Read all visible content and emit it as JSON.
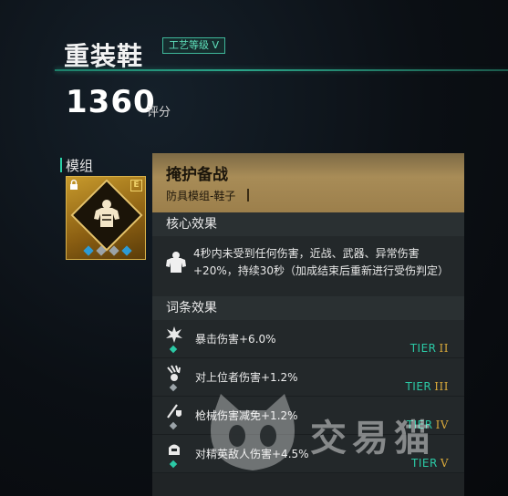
{
  "item": {
    "name": "重装鞋",
    "craft_badge": "工艺等级 V",
    "score": "1360",
    "score_unit": "评分"
  },
  "module_section": {
    "label": "模组",
    "grade_letter": "E",
    "icons": {
      "lock": "lock-icon",
      "figure": "armored-torso-icon"
    },
    "dots": [
      "#2d9bd6",
      "#9ba3a8",
      "#9ba3a8",
      "#2d9bd6"
    ]
  },
  "detail": {
    "title": "掩护备战",
    "subtitle": "防具模组-鞋子",
    "core_header": "核心效果",
    "core_text": "4秒内未受到任何伤害，近战、武器、异常伤害+20%，持续30秒（加成结束后重新进行受伤判定）",
    "affix_header": "词条效果",
    "affixes": [
      {
        "label": "暴击伤害+6.0%",
        "tier": "TIER",
        "tier_num": "II",
        "icon": "burst-icon",
        "dot_color": "#2bc9a5"
      },
      {
        "label": "对上位者伤害+1.2%",
        "tier": "TIER",
        "tier_num": "III",
        "icon": "claw-icon",
        "dot_color": "#9ba3a8"
      },
      {
        "label": "枪械伤害减免+1.2%",
        "tier": "TIER",
        "tier_num": "IV",
        "icon": "gun-shield-icon",
        "dot_color": "#9ba3a8"
      },
      {
        "label": "对精英敌人伤害+4.5%",
        "tier": "TIER",
        "tier_num": "V",
        "icon": "elite-icon",
        "dot_color": "#2bc9a5"
      }
    ]
  },
  "watermark": {
    "text": "交易猫"
  },
  "colors": {
    "accent": "#2bd0a7",
    "gold": "#c79a2c",
    "tier_num": "#d9a93a"
  }
}
